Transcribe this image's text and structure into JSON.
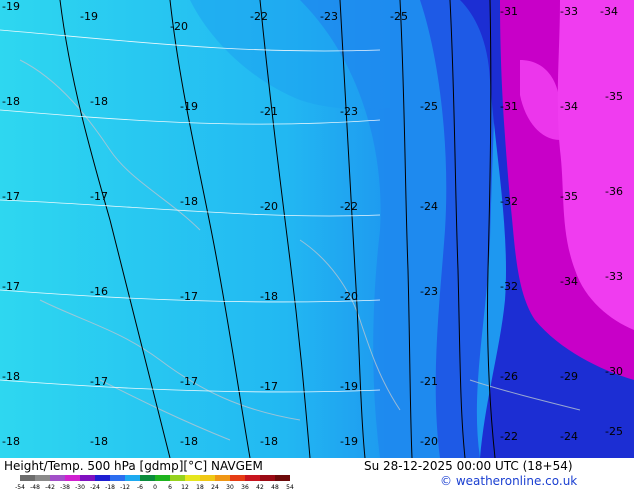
{
  "map": {
    "product_label": "Height/Temp. 500 hPa [gdmp][°C] NAVGEM",
    "valid_time": "Su 28-12-2025 00:00 UTC (18+54)",
    "credit": "© weatheronline.co.uk",
    "contour_labels_sample": [
      "-17",
      "-18",
      "-19",
      "-20",
      "-21",
      "-22",
      "-23",
      "-24",
      "-25",
      "-26",
      "-30",
      "-32",
      "-33",
      "-34",
      "-35",
      "-36"
    ],
    "legend": {
      "ticks": [
        "-54",
        "-48",
        "-42",
        "-38",
        "-30",
        "-24",
        "-18",
        "-12",
        "-6",
        "0",
        "6",
        "12",
        "18",
        "24",
        "30",
        "36",
        "42",
        "48",
        "54"
      ],
      "colors": [
        "#6c6c6c",
        "#8a8a8a",
        "#a24fc8",
        "#d020d0",
        "#8010c0",
        "#1e1ed2",
        "#2d6ef0",
        "#1eaaf0",
        "#0a8c3c",
        "#1eb41e",
        "#96d21e",
        "#e6e61e",
        "#f0c814",
        "#f09614",
        "#e63c14",
        "#c8141e",
        "#9b0a14",
        "#6e0a0a"
      ]
    },
    "colors": {
      "cyan_light": "#2ed7f0",
      "cyan_mid": "#22b8f2",
      "blue_mid": "#1e8ef0",
      "blue": "#1e5ae6",
      "blue_dark": "#1c2ed3",
      "purple": "#c800c8",
      "magenta": "#f03cf0"
    }
  }
}
